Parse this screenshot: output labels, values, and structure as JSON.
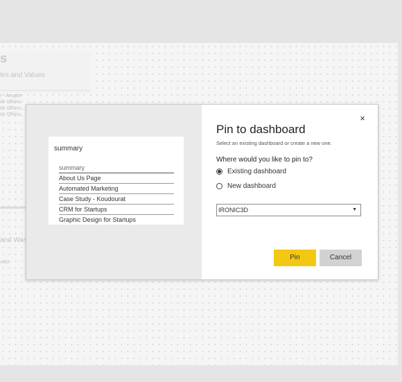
{
  "background": {
    "title_fragment": "s",
    "subtitle_fragment": "les and Values",
    "list_fragments": [
      "r - Aespire",
      "ith Offsho",
      "ith Offsho",
      "ith Offsho"
    ],
    "lower_fragment": "and Was",
    "lower_small": "rello"
  },
  "preview": {
    "title": "summary",
    "items": [
      "summary",
      "About Us Page",
      "Automated Marketing",
      "Case Study - Koudourat",
      "CRM for Startups",
      "Graphic Design for Startups"
    ]
  },
  "dialog": {
    "title": "Pin to dashboard",
    "subtitle": "Select an existing dashboard or create a new one.",
    "question": "Where would you like to pin to?",
    "options": [
      {
        "label": "Existing dashboard",
        "selected": true
      },
      {
        "label": "New dashboard",
        "selected": false
      }
    ],
    "dashboard_select": "IRONIC3D",
    "pin_label": "Pin",
    "cancel_label": "Cancel",
    "close_glyph": "×",
    "caret_glyph": "▼"
  },
  "colors": {
    "pin_button": "#f2c811",
    "cancel_button": "#d2d2d2",
    "preview_bg": "#eaeaea"
  }
}
